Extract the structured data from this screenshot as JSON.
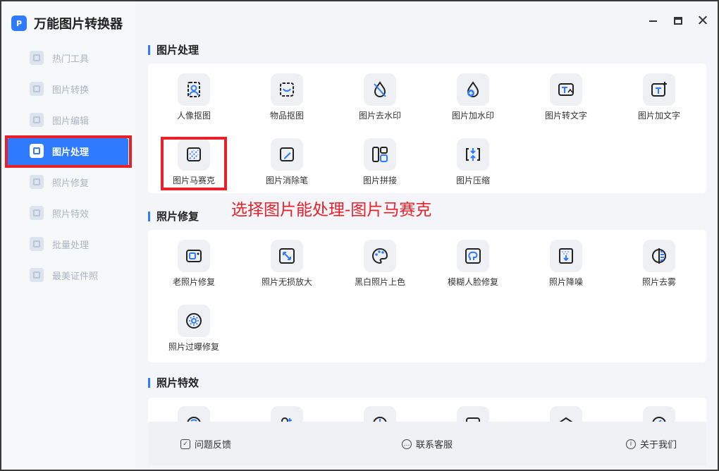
{
  "app": {
    "title": "万能图片转换器",
    "logo_text": "P"
  },
  "window": {
    "minimize": "minimize",
    "maximize": "maximize",
    "close": "close"
  },
  "sidebar": {
    "items": [
      {
        "label": "热门工具",
        "icon": "hot-tools-icon",
        "active": false
      },
      {
        "label": "图片转换",
        "icon": "convert-icon",
        "active": false
      },
      {
        "label": "图片编辑",
        "icon": "edit-icon",
        "active": false
      },
      {
        "label": "图片处理",
        "icon": "process-icon",
        "active": true
      },
      {
        "label": "照片修复",
        "icon": "repair-icon",
        "active": false
      },
      {
        "label": "照片特效",
        "icon": "effects-icon",
        "active": false
      },
      {
        "label": "批量处理",
        "icon": "batch-icon",
        "active": false
      },
      {
        "label": "最美证件照",
        "icon": "id-photo-icon",
        "active": false
      }
    ]
  },
  "sections": [
    {
      "title": "图片处理",
      "tools": [
        {
          "label": "人像抠图",
          "icon": "portrait-cutout-icon"
        },
        {
          "label": "物品抠图",
          "icon": "object-cutout-icon"
        },
        {
          "label": "图片去水印",
          "icon": "remove-watermark-icon"
        },
        {
          "label": "图片加水印",
          "icon": "add-watermark-icon"
        },
        {
          "label": "图片转文字",
          "icon": "image-to-text-icon"
        },
        {
          "label": "图片加文字",
          "icon": "add-text-icon"
        },
        {
          "label": "图片马赛克",
          "icon": "mosaic-icon"
        },
        {
          "label": "图片消除笔",
          "icon": "eraser-pen-icon"
        },
        {
          "label": "图片拼接",
          "icon": "stitch-icon"
        },
        {
          "label": "图片压缩",
          "icon": "compress-icon"
        }
      ]
    },
    {
      "title": "照片修复",
      "tools": [
        {
          "label": "老照片修复",
          "icon": "old-photo-icon"
        },
        {
          "label": "照片无损放大",
          "icon": "upscale-icon"
        },
        {
          "label": "黑白照片上色",
          "icon": "colorize-icon"
        },
        {
          "label": "模糊人脸修复",
          "icon": "face-restore-icon"
        },
        {
          "label": "照片降噪",
          "icon": "denoise-icon"
        },
        {
          "label": "照片去雾",
          "icon": "dehaze-icon"
        },
        {
          "label": "照片过曝修复",
          "icon": "overexposure-icon"
        }
      ]
    },
    {
      "title": "照片特效",
      "tools": [
        {
          "label": "",
          "icon": "effect-icon-1"
        },
        {
          "label": "",
          "icon": "effect-icon-2"
        },
        {
          "label": "",
          "icon": "effect-icon-3"
        },
        {
          "label": "",
          "icon": "effect-icon-4"
        },
        {
          "label": "",
          "icon": "effect-icon-5"
        },
        {
          "label": "",
          "icon": "effect-icon-6"
        }
      ]
    }
  ],
  "annotation": "选择图片能处理-图片马赛克",
  "footer": {
    "feedback": "问题反馈",
    "support": "联系客服",
    "about": "关于我们"
  },
  "colors": {
    "accent": "#2f7bff",
    "highlight": "#e8202a"
  }
}
